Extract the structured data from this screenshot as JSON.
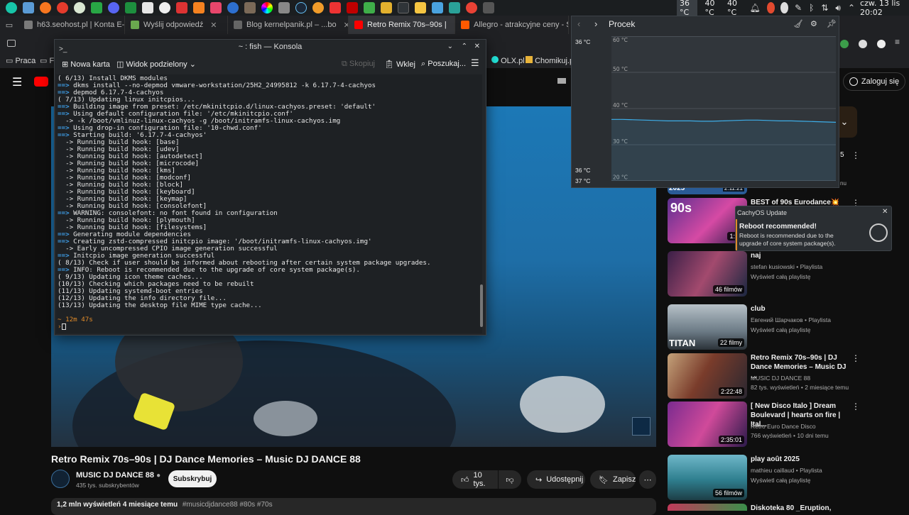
{
  "panel": {
    "temps": [
      "36 °C",
      "40 °C",
      "40 °C"
    ],
    "clock": "czw. 13 lis 20:02"
  },
  "browser": {
    "tabs": [
      {
        "label": "h63.seohost.pl | Konta E-m",
        "color": "#7a7a7a"
      },
      {
        "label": "Wyślij odpowiedź",
        "color": "#6aa84f"
      },
      {
        "label": "Blog kernelpanik.pl – ...bo",
        "color": "#888888"
      },
      {
        "label": "Retro Remix 70s–90s |",
        "color": "#ff0000"
      },
      {
        "label": "Allegro - atrakcyjne ceny - S",
        "color": "#ff5a00"
      }
    ],
    "bookmarks": [
      "Praca",
      "Fi",
      "OLX.pl",
      "Chomikuj.pl"
    ],
    "sign_in": "Zaloguj się"
  },
  "konsole": {
    "title": "~ : fish — Konsola",
    "new_tab": "Nowa karta",
    "split_view": "Widok podzielony",
    "copy": "Skopiuj",
    "paste": "Wklej",
    "search": "Poszukaj...",
    "lines": [
      "( 6/13) Install DKMS modules",
      "==> dkms install --no-depmod vmware-workstation/25H2_24995812 -k 6.17.7-4-cachyos",
      "==> depmod 6.17.7-4-cachyos",
      "( 7/13) Updating linux initcpios...",
      "==> Building image from preset: /etc/mkinitcpio.d/linux-cachyos.preset: 'default'",
      "==> Using default configuration file: '/etc/mkinitcpio.conf'",
      "  -> -k /boot/vmlinuz-linux-cachyos -g /boot/initramfs-linux-cachyos.img",
      "==> Using drop-in configuration file: '10-chwd.conf'",
      "==> Starting build: '6.17.7-4-cachyos'",
      "  -> Running build hook: [base]",
      "  -> Running build hook: [udev]",
      "  -> Running build hook: [autodetect]",
      "  -> Running build hook: [microcode]",
      "  -> Running build hook: [kms]",
      "  -> Running build hook: [modconf]",
      "  -> Running build hook: [block]",
      "  -> Running build hook: [keyboard]",
      "  -> Running build hook: [keymap]",
      "  -> Running build hook: [consolefont]",
      "==> WARNING: consolefont: no font found in configuration",
      "  -> Running build hook: [plymouth]",
      "  -> Running build hook: [filesystems]",
      "==> Generating module dependencies",
      "==> Creating zstd-compressed initcpio image: '/boot/initramfs-linux-cachyos.img'",
      "  -> Early uncompressed CPIO image generation successful",
      "==> Initcpio image generation successful",
      "( 8/13) Check if user should be informed about rebooting after certain system package upgrades.",
      "==> INFO: Reboot is recommended due to the upgrade of core system package(s).",
      "( 9/13) Updating icon theme caches...",
      "(10/13) Checking which packages need to be rebuilt",
      "(11/13) Updating systemd-boot entries",
      "(12/13) Updating the info directory file...",
      "(13/13) Updating the desktop file MIME type cache..."
    ],
    "prompt_time": "12m 47s"
  },
  "monitor": {
    "title": "Procek",
    "left_top": "36 °C",
    "left_bottom_1": "36 °C",
    "left_bottom_2": "37 °C",
    "y_ticks": [
      "60 °C",
      "50 °C",
      "40 °C",
      "30 °C",
      "20 °C"
    ]
  },
  "notification": {
    "app": "CachyOS Update",
    "title": "Reboot recommended!",
    "body": "Reboot is recommended due to the upgrade of core system package(s)."
  },
  "video": {
    "title": "Retro Remix 70s–90s | DJ Dance Memories – Music DJ DANCE 88",
    "channel": "MUSIC DJ DANCE 88",
    "subs": "435 tys. subskrybentów",
    "subscribe": "Subskrybuj",
    "likes": "10 tys.",
    "share": "Udostępnij",
    "save": "Zapisz",
    "views": "1,2 mln wyświetleń  4 miesiące temu",
    "tags": "#musicdjdance88 #80s #70s"
  },
  "sidebar": {
    "top_partial_duration": "2:11:21",
    "top_partial_year": "2025",
    "items": [
      {
        "title": "BEST of 90s Eurodance💥",
        "meta1": "",
        "meta2": "",
        "duration": "1:36"
      },
      {
        "title": "naj",
        "meta1": "stefan kusiowski • Playlista",
        "meta2": "Wyświetl całą playlistę",
        "duration": "46 filmów"
      },
      {
        "title": "club",
        "meta1": "Евгений Шарчаков • Playlista",
        "meta2": "Wyświetl całą playlistę",
        "duration": "22 filmy"
      },
      {
        "title": "Retro Remix 70s–90s | DJ Dance Memories – Music DJ ...",
        "meta1": "MUSIC DJ DANCE 88",
        "meta2": "82 tys. wyświetleń • 2 miesiące temu",
        "duration": "2:22:48"
      },
      {
        "title": "[ New Disco Italo ] Dream Boulevard | hearts on fire | Ital...",
        "meta1": "Retro Euro Dance Disco",
        "meta2": "766 wyświetleń • 10 dni temu",
        "duration": "2:35:01"
      },
      {
        "title": "play août 2025",
        "meta1": "mathieu caillaud • Playlista",
        "meta2": "Wyświetl całą playlistę",
        "duration": "56 filmów"
      },
      {
        "title": "Diskoteka 80 _Eruption,",
        "meta1": "",
        "meta2": "",
        "duration": ""
      }
    ]
  }
}
